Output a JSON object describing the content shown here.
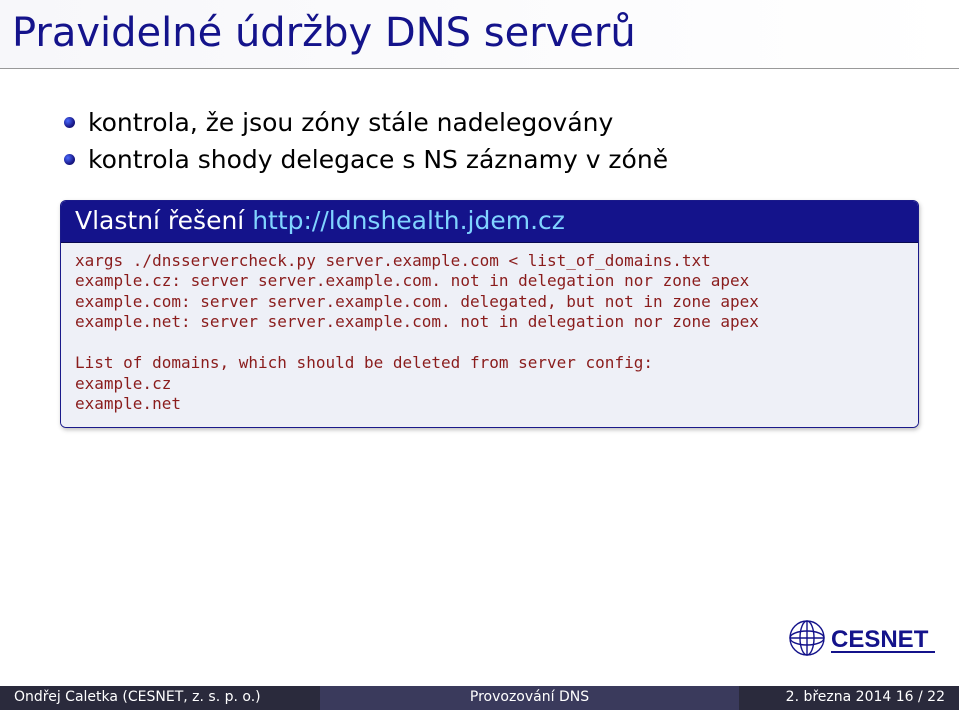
{
  "title": "Pravidelné údržby DNS serverů",
  "bullets": [
    "kontrola, že jsou zóny stále nadelegovány",
    "kontrola shody delegace s NS záznamy v zóně"
  ],
  "block": {
    "header_prefix": "Vlastní řešení ",
    "header_link": "http://ldnshealth.jdem.cz",
    "body": "xargs ./dnsservercheck.py server.example.com < list_of_domains.txt\nexample.cz: server server.example.com. not in delegation nor zone apex\nexample.com: server server.example.com. delegated, but not in zone apex\nexample.net: server server.example.com. not in delegation nor zone apex\n\nList of domains, which should be deleted from server config:\nexample.cz\nexample.net"
  },
  "logo_text": "CESNET",
  "footer": {
    "left": "Ondřej Caletka (CESNET, z. s. p. o.)",
    "center": "Provozování DNS",
    "right": "2. března 2014    16 / 22"
  }
}
